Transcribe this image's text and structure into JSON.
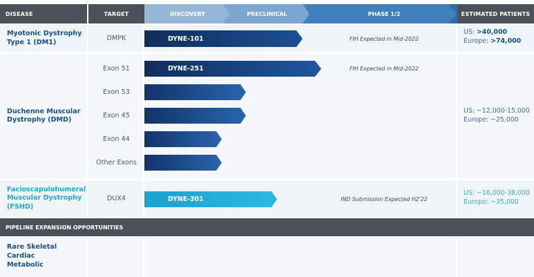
{
  "header": {
    "disease": "DISEASE",
    "target": "TARGET",
    "discovery": "DISCOVERY",
    "preclinical": "PRECLINICAL",
    "phase": "PHASE 1/2",
    "patients": "ESTIMATED PATIENTS"
  },
  "rows": [
    {
      "disease_line1": "Myotonic Dystrophy",
      "disease_line2": "Type 1 (DM1)",
      "target": "DMPK",
      "program": "DYNE-101",
      "progress": 0.5,
      "note": "FIH Expected in Mid-2022",
      "patients_us_label": "US: ",
      "patients_us": ">40,000",
      "patients_eu_label": "Europe: ",
      "patients_eu": ">74,000"
    },
    {
      "disease_line1": "Duchenne Muscular",
      "disease_line2": "Dystrophy (DMD)",
      "exons": [
        {
          "target": "Exon 51",
          "program": "DYNE-251",
          "note": "FIH Expected in Mid-2022"
        },
        {
          "target": "Exon 53",
          "program": "",
          "note": ""
        },
        {
          "target": "Exon 45",
          "program": "",
          "note": ""
        },
        {
          "target": "Exon 44",
          "program": "",
          "note": ""
        },
        {
          "target": "Other Exons",
          "program": "",
          "note": ""
        }
      ],
      "patients_us": "US: ~12,000-15,000",
      "patients_eu": "Europe: ~25,000"
    },
    {
      "disease_line1": "Facioscapulohumeral",
      "disease_line2": "Muscular Dystrophy",
      "disease_line3": "(FSHD)",
      "target": "DUX4",
      "program": "DYNE-301",
      "note": "IND Submission Expected H2'22",
      "patients_us": "US: ~16,000-38,000",
      "patients_eu": "Europe: ~35,000"
    }
  ],
  "expansion": {
    "title": "PIPELINE EXPANSION OPPORTUNITIES",
    "items": [
      "Rare Skeletal",
      "Cardiac",
      "Metabolic"
    ]
  }
}
